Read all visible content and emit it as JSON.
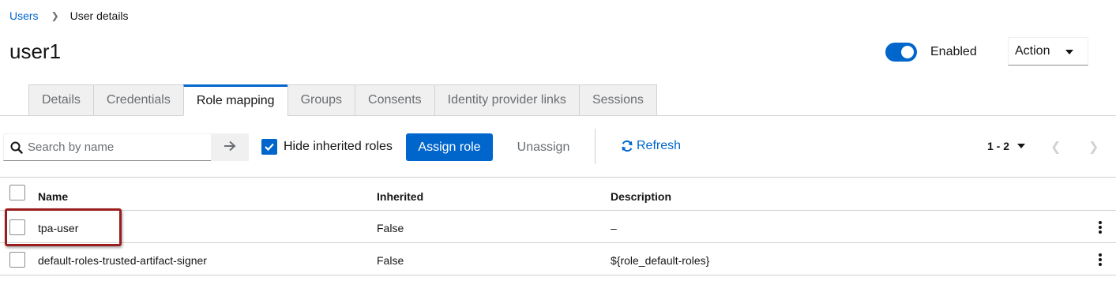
{
  "breadcrumb": {
    "parent": "Users",
    "current": "User details"
  },
  "page": {
    "title": "user1"
  },
  "status": {
    "enabled_label": "Enabled",
    "enabled": true
  },
  "action": {
    "label": "Action"
  },
  "tabs": [
    {
      "label": "Details",
      "active": false
    },
    {
      "label": "Credentials",
      "active": false
    },
    {
      "label": "Role mapping",
      "active": true
    },
    {
      "label": "Groups",
      "active": false
    },
    {
      "label": "Consents",
      "active": false
    },
    {
      "label": "Identity provider links",
      "active": false
    },
    {
      "label": "Sessions",
      "active": false
    }
  ],
  "toolbar": {
    "search_placeholder": "Search by name",
    "hide_inherited_label": "Hide inherited roles",
    "hide_inherited_checked": true,
    "assign_label": "Assign role",
    "unassign_label": "Unassign",
    "refresh_label": "Refresh",
    "pagination": "1 - 2"
  },
  "table": {
    "columns": [
      "Name",
      "Inherited",
      "Description"
    ],
    "rows": [
      {
        "name": "tpa-user",
        "inherited": "False",
        "description": "–"
      },
      {
        "name": "default-roles-trusted-artifact-signer",
        "inherited": "False",
        "description": "${role_default-roles}"
      }
    ]
  },
  "colors": {
    "accent": "#0066cc",
    "highlight": "#9b1c1c"
  }
}
